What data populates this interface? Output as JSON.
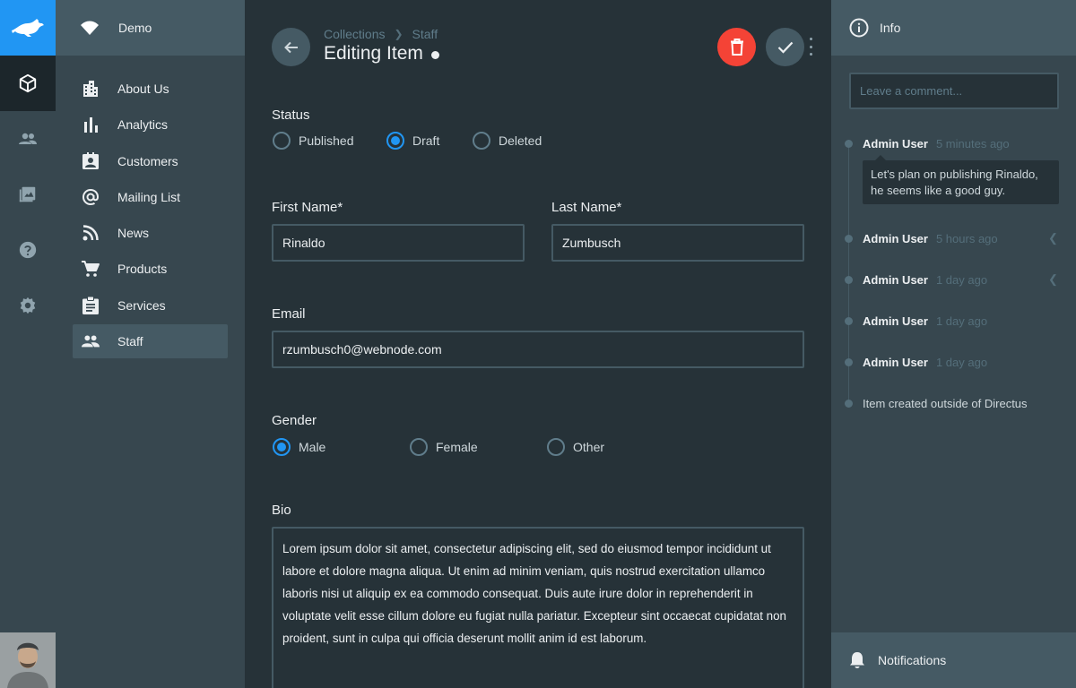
{
  "app": {
    "project_name": "Demo"
  },
  "rail": {
    "items": [
      "box-icon",
      "users-icon",
      "images-icon",
      "help-icon",
      "settings-icon"
    ],
    "active": "box-icon"
  },
  "nav": {
    "items": [
      {
        "label": "About Us",
        "icon": "building-icon"
      },
      {
        "label": "Analytics",
        "icon": "bar-chart-icon"
      },
      {
        "label": "Customers",
        "icon": "contact-card-icon"
      },
      {
        "label": "Mailing List",
        "icon": "at-sign-icon"
      },
      {
        "label": "News",
        "icon": "rss-icon"
      },
      {
        "label": "Products",
        "icon": "cart-icon"
      },
      {
        "label": "Services",
        "icon": "clipboard-icon"
      },
      {
        "label": "Staff",
        "icon": "people-icon"
      }
    ],
    "active": "Staff"
  },
  "header": {
    "breadcrumb": [
      "Collections",
      "Staff"
    ],
    "title": "Editing Item"
  },
  "form": {
    "status": {
      "label": "Status",
      "options": [
        "Published",
        "Draft",
        "Deleted"
      ],
      "selected": "Draft"
    },
    "first_name": {
      "label": "First Name*",
      "value": "Rinaldo"
    },
    "last_name": {
      "label": "Last Name*",
      "value": "Zumbusch"
    },
    "email": {
      "label": "Email",
      "value": "rzumbusch0@webnode.com"
    },
    "gender": {
      "label": "Gender",
      "options": [
        "Male",
        "Female",
        "Other"
      ],
      "selected": "Male"
    },
    "bio": {
      "label": "Bio",
      "value": "Lorem ipsum dolor sit amet, consectetur adipiscing elit, sed do eiusmod tempor incididunt ut labore et dolore magna aliqua. Ut enim ad minim veniam, quis nostrud exercitation ullamco laboris nisi ut aliquip ex ea commodo consequat. Duis aute irure dolor in reprehenderit in voluptate velit esse cillum dolore eu fugiat nulla pariatur. Excepteur sint occaecat cupidatat non proident, sunt in culpa qui officia deserunt mollit anim id est laborum."
    }
  },
  "info": {
    "title": "Info",
    "comment_placeholder": "Leave a comment...",
    "activity": [
      {
        "user": "Admin User",
        "time": "5 minutes ago",
        "comment": "Let's plan on publishing Rinaldo, he seems like a good guy."
      },
      {
        "user": "Admin User",
        "time": "5 hours ago"
      },
      {
        "user": "Admin User",
        "time": "1 day ago"
      },
      {
        "user": "Admin User",
        "time": "1 day ago"
      },
      {
        "user": "Admin User",
        "time": "1 day ago"
      },
      {
        "text": "Item created outside of Directus"
      }
    ],
    "notifications_label": "Notifications"
  },
  "colors": {
    "accent": "#2196f3",
    "danger": "#f44336",
    "background": "#263238",
    "sidebar": "#37474f"
  }
}
